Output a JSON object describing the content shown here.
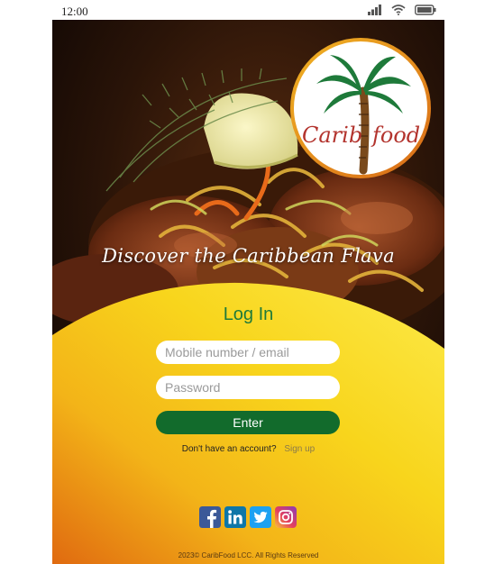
{
  "status_bar": {
    "time": "12:00"
  },
  "hero": {
    "tagline": "Discover the Caribbean Flava"
  },
  "logo": {
    "text_left": "Carib",
    "text_right": "food"
  },
  "login": {
    "title": "Log In",
    "email_placeholder": "Mobile number / email",
    "email_value": "",
    "password_placeholder": "Password",
    "password_value": "",
    "enter_label": "Enter",
    "signup_prompt": "Don't have an account?",
    "signup_link": "Sign up"
  },
  "social": {
    "icons": [
      "facebook-icon",
      "linkedin-icon",
      "twitter-icon",
      "instagram-icon"
    ]
  },
  "footer": {
    "copyright": "2023© CaribFood LCC. All Rights Reserved"
  },
  "colors": {
    "accent_green": "#1f7a3a",
    "button_green": "#126b2c",
    "panel_yellow": "#f6d21a",
    "panel_orange": "#e38912",
    "logo_red": "#b3342e"
  }
}
